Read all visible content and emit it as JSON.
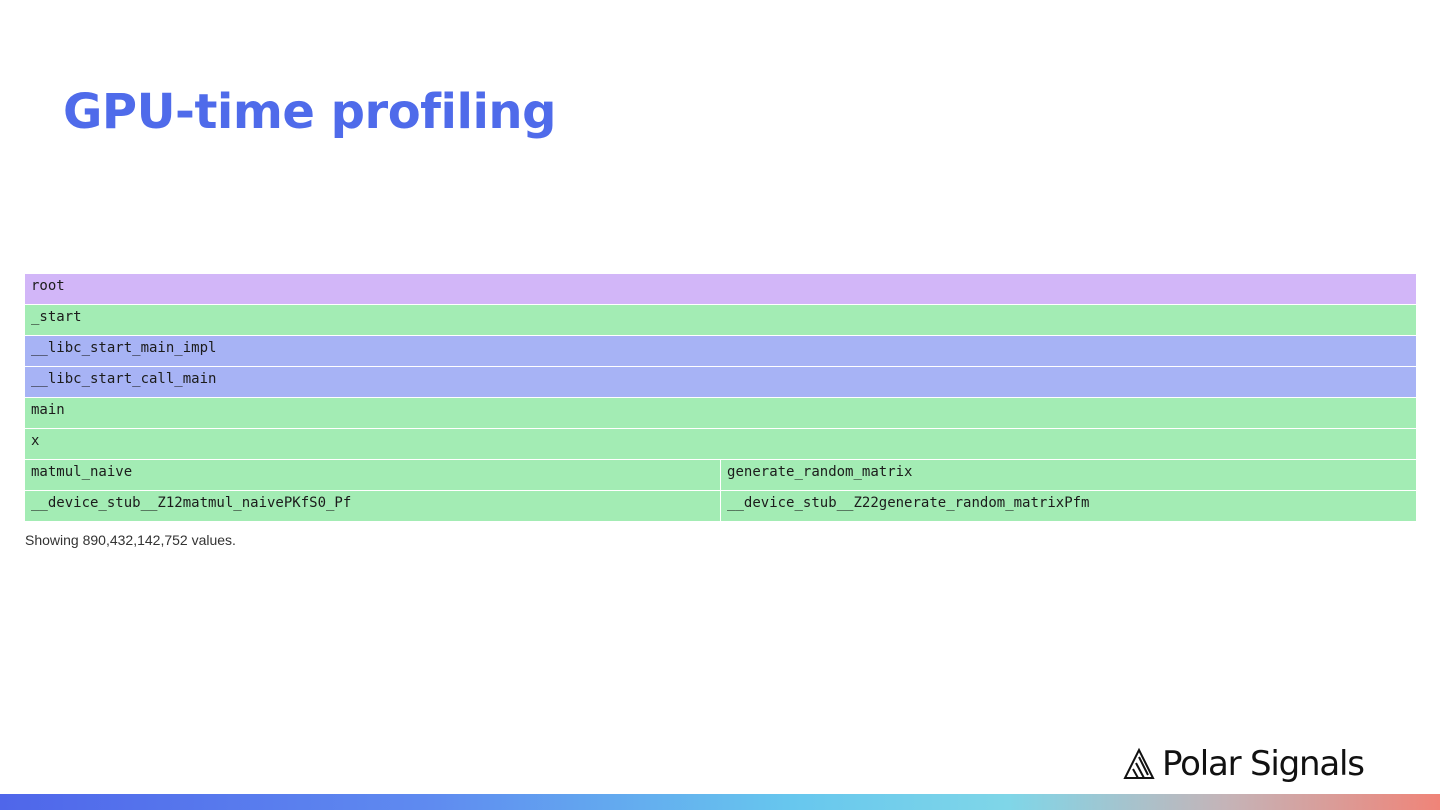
{
  "slide": {
    "title": "GPU-time profiling"
  },
  "flamegraph": {
    "rows": [
      [
        {
          "name": "root",
          "width_pct": 100,
          "color": "#d2b6f8"
        }
      ],
      [
        {
          "name": "_start",
          "width_pct": 100,
          "color": "#a3ecb4"
        }
      ],
      [
        {
          "name": "__libc_start_main_impl",
          "width_pct": 100,
          "color": "#a7b3f5"
        }
      ],
      [
        {
          "name": "__libc_start_call_main",
          "width_pct": 100,
          "color": "#a7b3f5"
        }
      ],
      [
        {
          "name": "main",
          "width_pct": 100,
          "color": "#a3ecb4"
        }
      ],
      [
        {
          "name": "x",
          "width_pct": 100,
          "color": "#a3ecb4"
        }
      ],
      [
        {
          "name": "matmul_naive",
          "width_pct": 50.04,
          "color": "#a3ecb4"
        },
        {
          "name": "generate_random_matrix",
          "width_pct": 49.96,
          "color": "#a3ecb4"
        }
      ],
      [
        {
          "name": "__device_stub__Z12matmul_naivePKfS0_Pf",
          "width_pct": 50.04,
          "color": "#a3ecb4"
        },
        {
          "name": "__device_stub__Z22generate_random_matrixPfm",
          "width_pct": 49.96,
          "color": "#a3ecb4"
        }
      ]
    ],
    "status_text": "Showing 890,432,142,752 values."
  },
  "brand": {
    "name": "Polar Signals",
    "logo_icon": "polar-signals-logo-icon",
    "accent_color": "#4f6bea"
  }
}
